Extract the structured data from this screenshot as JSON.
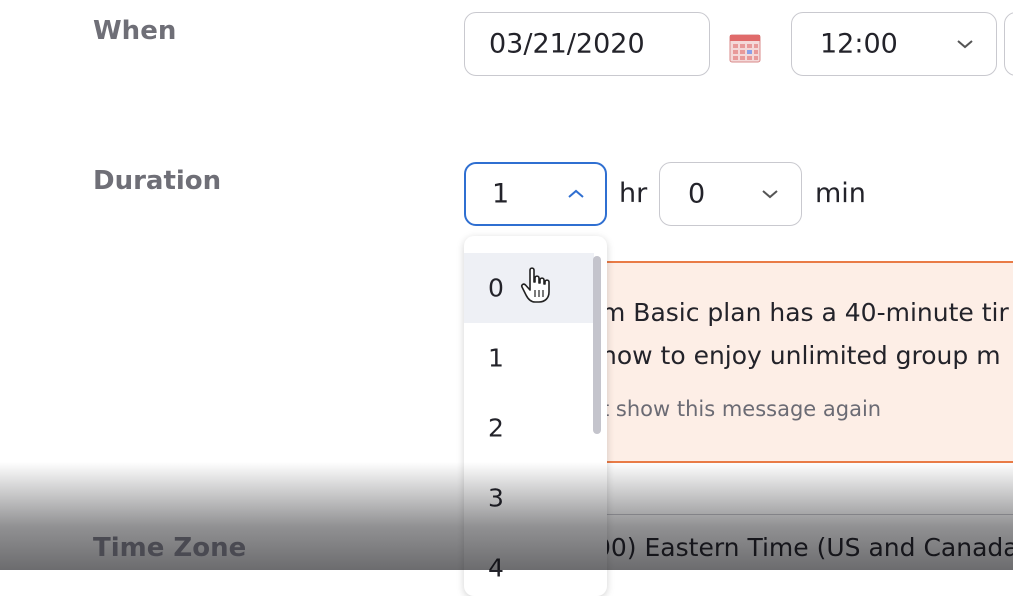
{
  "when": {
    "label": "When",
    "date_value": "03/21/2020",
    "time_value": "12:00",
    "icon": "calendar-icon"
  },
  "duration": {
    "label": "Duration",
    "hours_value": "1",
    "hours_unit": "hr",
    "minutes_value": "0",
    "minutes_unit": "min",
    "hours_options": [
      "0",
      "1",
      "2",
      "3",
      "4"
    ],
    "hovered_option": "0"
  },
  "banner": {
    "line1": "m Basic plan has a 40-minute tir",
    "line2": "now to enjoy unlimited group m",
    "dismiss": "t show this message again"
  },
  "timezone": {
    "label": "Time Zone",
    "value": "00) Eastern Time (US and Canada"
  },
  "colors": {
    "focus_border": "#2f6fd1",
    "warning_border": "#e97b46",
    "warning_bg": "#fdeee6",
    "label_gray": "#6f6f77"
  }
}
